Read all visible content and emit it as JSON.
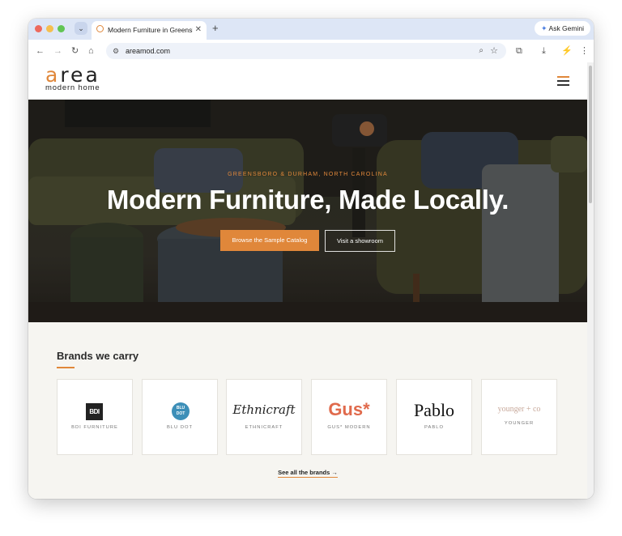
{
  "browser": {
    "tab": {
      "title": "Modern Furniture in Greensboro & Durham"
    },
    "gemini_label": "Ask Gemini",
    "url": "areamod.com"
  },
  "site": {
    "logo_word": "area",
    "logo_sub": "modern home"
  },
  "hero": {
    "kicker": "GREENSBORO & DURHAM, NORTH CAROLINA",
    "title": "Modern Furniture, Made Locally.",
    "primary_button": "Browse the Sample Catalog",
    "secondary_button": "Visit a showroom"
  },
  "brands": {
    "title": "Brands we carry",
    "items": [
      {
        "logo": "BDI",
        "name": "BDI FURNITURE"
      },
      {
        "logo": "BLU DOT",
        "name": "BLU DOT"
      },
      {
        "logo": "Ethnicraft",
        "name": "ETHNICRAFT"
      },
      {
        "logo": "Gus*",
        "name": "GUS* MODERN"
      },
      {
        "logo": "Pablo",
        "name": "PABLO"
      },
      {
        "logo": "younger + co",
        "name": "YOUNGER"
      }
    ],
    "see_all": "See all the brands →"
  },
  "colors": {
    "accent": "#e0873a",
    "page_bg": "#f6f5f1"
  }
}
